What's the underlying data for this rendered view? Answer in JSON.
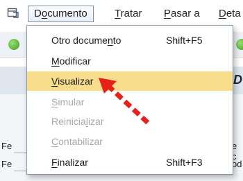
{
  "menubar": {
    "icon": "window-menu-icon",
    "items": [
      {
        "pre": "D",
        "mn": "o",
        "post": "cumento"
      },
      {
        "pre": "",
        "mn": "T",
        "post": "ratar"
      },
      {
        "pre": "",
        "mn": "P",
        "post": "asar a"
      },
      {
        "pre": "",
        "mn": "D",
        "post": "eta"
      }
    ]
  },
  "dropdown": {
    "items": [
      {
        "pre": "Otro docume",
        "mn": "n",
        "post": "to",
        "shortcut": "Shift+F5",
        "state": "normal"
      },
      {
        "pre": "",
        "mn": "M",
        "post": "odificar",
        "shortcut": "",
        "state": "normal"
      },
      {
        "pre": "",
        "mn": "V",
        "post": "isualizar",
        "shortcut": "",
        "state": "highlight"
      },
      {
        "pre": "",
        "mn": "S",
        "post": "imular",
        "shortcut": "",
        "state": "disabled"
      },
      {
        "pre": "Reinicia",
        "mn": "l",
        "post": "izar",
        "shortcut": "",
        "state": "disabled"
      },
      {
        "pre": "",
        "mn": "C",
        "post": "ontabilizar",
        "shortcut": "",
        "state": "disabled"
      },
      {
        "pre": "",
        "mn": "F",
        "post": "inalizar",
        "shortcut": "Shift+F3",
        "state": "normal"
      }
    ]
  },
  "background": {
    "panel_letter": "D",
    "left_fragments": [
      "Fe",
      "Fe"
    ],
    "right_fragments": [
      "e c",
      "od"
    ]
  },
  "annotation": {
    "arrow_icon": "red-dashed-arrow-icon",
    "arrow_color": "#e8201a"
  },
  "colors": {
    "highlight": "#f8dd8a",
    "disabled_text": "#a8a8a8"
  }
}
